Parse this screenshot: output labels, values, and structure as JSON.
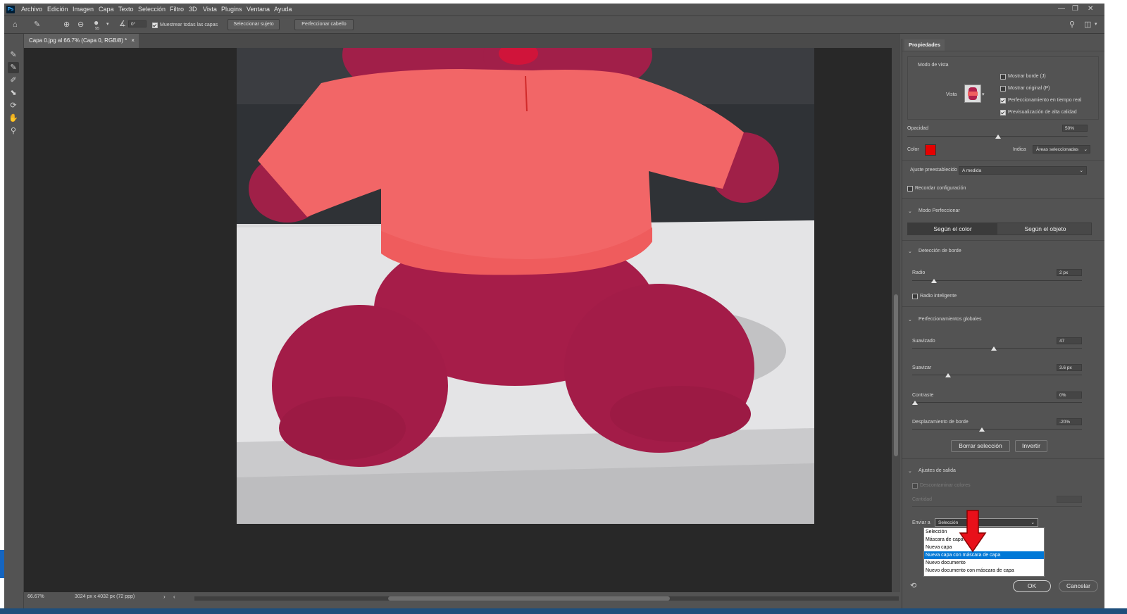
{
  "app": {
    "logo": "Ps"
  },
  "menu": [
    "Archivo",
    "Edición",
    "Imagen",
    "Capa",
    "Texto",
    "Selección",
    "Filtro",
    "3D",
    "Vista",
    "Plugins",
    "Ventana",
    "Ayuda"
  ],
  "options_bar": {
    "brush_size": "95",
    "angle_value": "0°",
    "sample_all_layers_label": "Muestrear todas las capas",
    "sample_all_layers_checked": true,
    "select_subject_label": "Seleccionar sujeto",
    "refine_hair_label": "Perfeccionar cabello"
  },
  "document": {
    "tab_title": "Capa 0.jpg al 66.7% (Capa 0, RGB/8) *",
    "tab_close": "×",
    "zoom": "66.67%",
    "doc_info": "3024 px x 4032 px (72 ppp)"
  },
  "panel": {
    "tab_label": "Propiedades",
    "view_mode": {
      "title": "Modo de vista",
      "view_label": "Vista",
      "options": [
        {
          "label": "Mostrar borde (J)",
          "checked": false
        },
        {
          "label": "Mostrar original (P)",
          "checked": false
        },
        {
          "label": "Perfeccionamiento en tiempo real",
          "checked": true
        },
        {
          "label": "Previsualización de alta calidad",
          "checked": true
        }
      ]
    },
    "opacity": {
      "label": "Opacidad",
      "value": "50%",
      "level": 0.5
    },
    "color": {
      "label": "Color",
      "swatch": "#e60000"
    },
    "indicates": {
      "label": "Indica",
      "value": "Áreas seleccionadas"
    },
    "preset": {
      "label": "Ajuste preestablecido",
      "value": "A medida"
    },
    "remember": {
      "label": "Recordar configuración",
      "checked": false
    },
    "refine_mode": {
      "title": "Modo Perfeccionar",
      "options": [
        "Según el color",
        "Según el objeto"
      ],
      "active_index": 0
    },
    "edge_detection": {
      "title": "Detección de borde",
      "radius_label": "Radio",
      "radius_value": "2 px",
      "radius_level": 0.12,
      "smart_radius_label": "Radio inteligente",
      "smart_radius_checked": false
    },
    "global_refinements": {
      "title": "Perfeccionamientos globales",
      "sliders": [
        {
          "label": "Suavizado",
          "value": "47",
          "level": 0.47
        },
        {
          "label": "Suavizar",
          "value": "3.6 px",
          "level": 0.2
        },
        {
          "label": "Contraste",
          "value": "0%",
          "level": 0.0
        },
        {
          "label": "Desplazamiento de borde",
          "value": "-20%",
          "level": 0.4
        }
      ],
      "clear_selection_label": "Borrar selección",
      "invert_label": "Invertir"
    },
    "output": {
      "title": "Ajustes de salida",
      "decontaminate_label": "Descontaminar colores",
      "amount_label": "Cantidad",
      "send_to_label": "Enviar a",
      "send_to_value": "Selección",
      "send_to_options": [
        "Selección",
        "Máscara de capa",
        "Nueva capa",
        "Nueva capa con máscara de capa",
        "Nuevo documento",
        "Nuevo documento con máscara de capa"
      ],
      "highlighted_option_index": 3
    },
    "ok_label": "OK",
    "cancel_label": "Cancelar"
  },
  "colors": {
    "overlay_red": "#e60000",
    "selection_highlight": "#0078d7",
    "arrow_red": "#e8101a"
  }
}
